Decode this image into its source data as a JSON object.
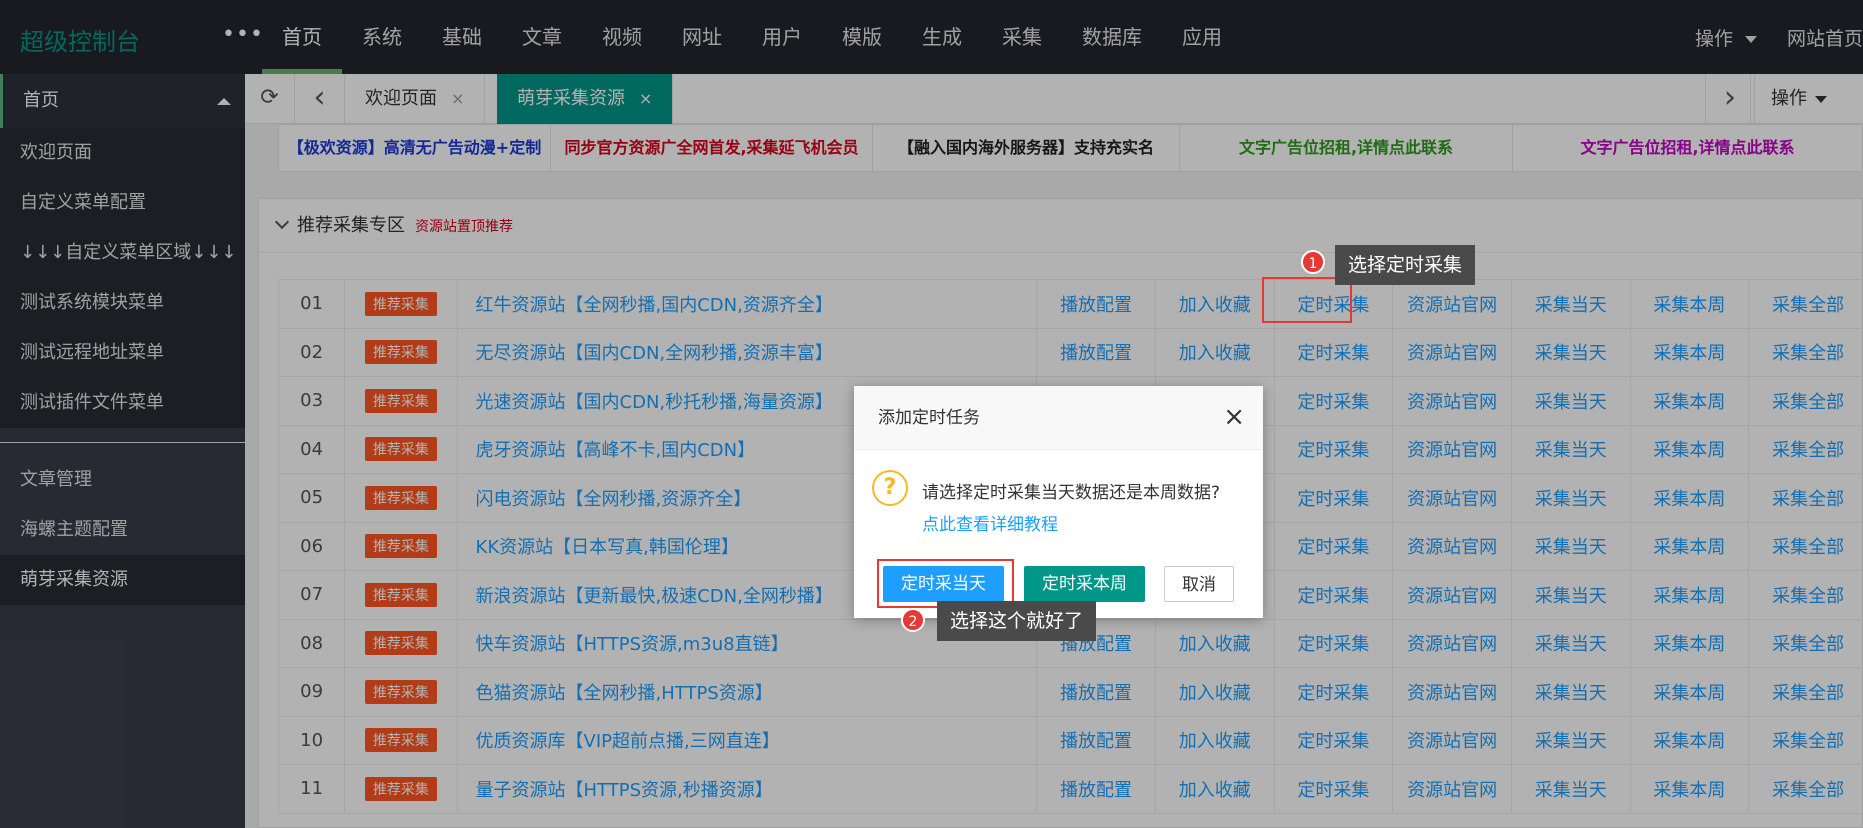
{
  "header": {
    "logo": "超级控制台",
    "dots": "•••",
    "nav": [
      "首页",
      "系统",
      "基础",
      "文章",
      "视频",
      "网址",
      "用户",
      "模版",
      "生成",
      "采集",
      "数据库",
      "应用"
    ],
    "ops_label": "操作",
    "site_home": "网站首页"
  },
  "sidebar": {
    "group": "首页",
    "items": [
      "欢迎页面",
      "自定义菜单配置",
      "↓↓↓自定义菜单区域↓↓↓",
      "测试系统模块菜单",
      "测试远程地址菜单",
      "测试插件文件菜单"
    ],
    "items2": [
      "文章管理",
      "海螺主题配置",
      "萌芽采集资源"
    ]
  },
  "tabs": {
    "refresh_icon": "⟳",
    "back_icon": "‹",
    "welcome": "欢迎页面",
    "active": "萌芽采集资源",
    "close": "×",
    "next_icon": "›",
    "ops": "操作"
  },
  "ads": [
    {
      "text": "【极欢资源】高清无广告动漫+定制",
      "color": "#1e39d8"
    },
    {
      "text": "同步官方资源广全网首发,采集延飞机会员",
      "color": "#d9001b"
    },
    {
      "text": "【融入国内海外服务器】支持充实名",
      "color": "#222222"
    },
    {
      "text": "文字广告位招租,详情点此联系",
      "color": "#2e9a1f"
    },
    {
      "text": "文字广告位招租,详情点此联系",
      "color": "#c200c2"
    }
  ],
  "panel": {
    "title": "推荐采集专区",
    "subtitle": "资源站置顶推荐"
  },
  "table": {
    "badge": "推荐采集",
    "actions": [
      "播放配置",
      "加入收藏",
      "定时采集",
      "资源站官网",
      "采集当天",
      "采集本周",
      "采集全部"
    ],
    "rows": [
      {
        "num": "01",
        "name": "红牛资源站【全网秒播,国内CDN,资源齐全】"
      },
      {
        "num": "02",
        "name": "无尽资源站【国内CDN,全网秒播,资源丰富】"
      },
      {
        "num": "03",
        "name": "光速资源站【国内CDN,秒托秒播,海量资源】"
      },
      {
        "num": "04",
        "name": "虎牙资源站【高峰不卡,国内CDN】"
      },
      {
        "num": "05",
        "name": "闪电资源站【全网秒播,资源齐全】"
      },
      {
        "num": "06",
        "name": "KK资源站【日本写真,韩国伦理】"
      },
      {
        "num": "07",
        "name": "新浪资源站【更新最快,极速CDN,全网秒播】"
      },
      {
        "num": "08",
        "name": "快车资源站【HTTPS资源,m3u8直链】"
      },
      {
        "num": "09",
        "name": "色猫资源站【全网秒播,HTTPS资源】"
      },
      {
        "num": "10",
        "name": "优质资源库【VIP超前点播,三网直连】"
      },
      {
        "num": "11",
        "name": "量子资源站【HTTPS资源,秒播资源】"
      }
    ]
  },
  "modal": {
    "title": "添加定时任务",
    "close": "×",
    "icon": "?",
    "message": "请选择定时采集当天数据还是本周数据?",
    "link": "点此查看详细教程",
    "btn_today": "定时采当天",
    "btn_week": "定时采本周",
    "btn_cancel": "取消"
  },
  "annotations": {
    "tip1_num": "1",
    "tip1": "选择定时采集",
    "tip2_num": "2",
    "tip2": "选择这个就好了"
  }
}
